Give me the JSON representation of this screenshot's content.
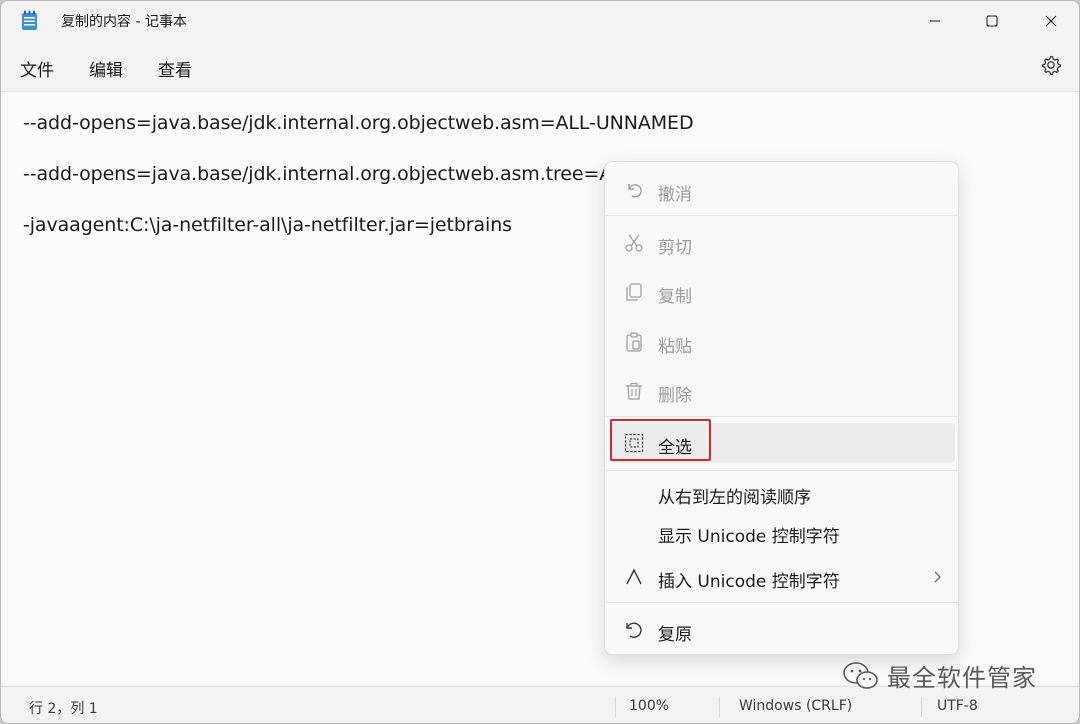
{
  "window": {
    "title": "复制的内容 - 记事本"
  },
  "menubar": {
    "file": "文件",
    "edit": "编辑",
    "view": "查看"
  },
  "editor": {
    "lines": [
      "--add-opens=java.base/jdk.internal.org.objectweb.asm=ALL-UNNAMED",
      "--add-opens=java.base/jdk.internal.org.objectweb.asm.tree=A",
      "-javaagent:C:\\ja-netfilter-all\\ja-netfilter.jar=jetbrains"
    ]
  },
  "context_menu": {
    "undo": "撤消",
    "cut": "剪切",
    "copy": "复制",
    "paste": "粘贴",
    "delete": "删除",
    "select_all": "全选",
    "rtl": "从右到左的阅读顺序",
    "show_unicode": "显示 Unicode 控制字符",
    "insert_unicode": "插入 Unicode 控制字符",
    "restore": "复原"
  },
  "statusbar": {
    "position": "行 2，列 1",
    "zoom": "100%",
    "line_ending": "Windows (CRLF)",
    "encoding": "UTF-8"
  },
  "watermark": {
    "text": "最全软件管家"
  },
  "colors": {
    "accent_highlight": "#d9282c",
    "app_icon": "#2f7fd6"
  }
}
